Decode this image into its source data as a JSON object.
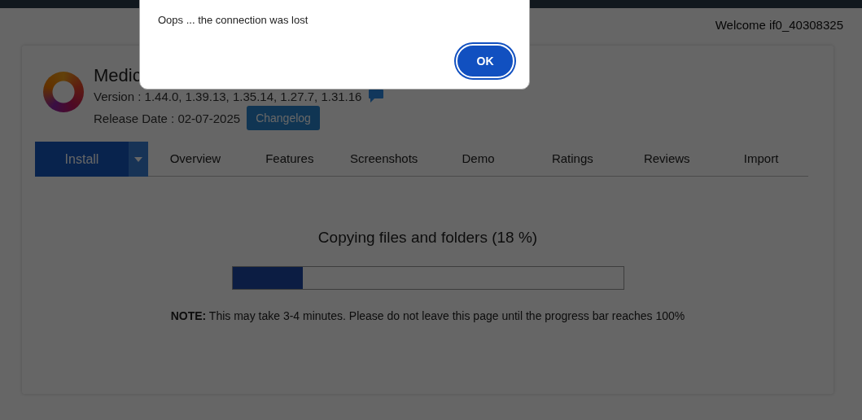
{
  "header": {
    "welcome": "Welcome if0_40308325"
  },
  "app": {
    "title": "Medic",
    "version": "Version : 1.44.0, 1.39.13, 1.35.14, 1.27.7, 1.31.16",
    "release_date": "Release Date : 02-07-2025",
    "changelog_button": "Changelog"
  },
  "install_button": "Install",
  "tabs": [
    {
      "label": "Overview",
      "selected": false
    },
    {
      "label": "Features",
      "selected": false
    },
    {
      "label": "Screenshots",
      "selected": false
    },
    {
      "label": "Demo",
      "selected": false
    },
    {
      "label": "Ratings",
      "selected": false
    },
    {
      "label": "Reviews",
      "selected": false
    },
    {
      "label": "Import",
      "selected": false
    }
  ],
  "progress": {
    "title": "Copying files and folders (18 %)",
    "level": 0.18,
    "note": "**NOTE:** This may take 3-4 minutes. Please do not leave this page until the progress bar reaches 100%"
  },
  "dialog": {
    "message": "Oops ... the connection was lost",
    "ok_button": "OK"
  }
}
